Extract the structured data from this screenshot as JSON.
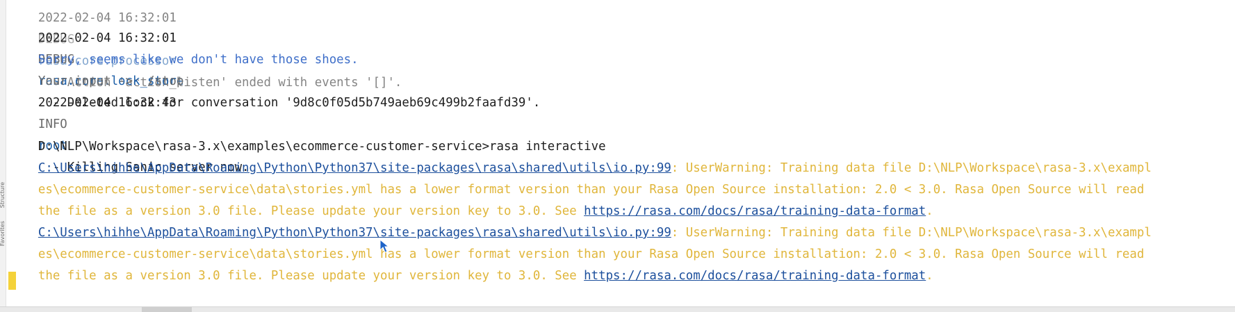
{
  "window": {
    "side_labels": [
      "Structure",
      "Favorites"
    ]
  },
  "lines": [
    {
      "ts": "2022-02-04 16:32:01",
      "level": "DEBUG",
      "logger": "rasa.core.processor",
      "msg": "  - Action 'action_listen' ended with events '[]'."
    },
    {
      "ts": "2022-02-04 16:32:01",
      "level": "DEBUG",
      "logger": "rasa.core.lock_store",
      "msg": "  - Deleted lock for conversation '9d8c0f05d5b749aeb69c499b2faafd39'."
    },
    {
      "bot": "Sorry, seems like we don't have those shoes."
    },
    {
      "prompt": "Your input ->  /stop"
    },
    {
      "ts": "2022-02-04 16:32:43",
      "level": "INFO",
      "logger": "root",
      "msg": "  - Killing Sanic server now."
    },
    {
      "command": "D:\\NLP\\Workspace\\rasa-3.x\\examples\\ecommerce-customer-service>rasa interactive"
    },
    {
      "path": "C:\\Users\\hihhe\\AppData\\Roaming\\Python\\Python37\\site-packages\\rasa\\shared\\utils\\io.py:99",
      "warn": ": UserWarning: Training data file D:\\NLP\\Workspace\\rasa-3.x\\exampl"
    },
    {
      "warn": "es\\ecommerce-customer-service\\data\\stories.yml has a lower format version than your Rasa Open Source installation: 2.0 < 3.0. Rasa Open Source will read"
    },
    {
      "warn": "the file as a version 3.0 file. Please update your version key to 3.0. See ",
      "url": "https://rasa.com/docs/rasa/training-data-format",
      "tail": "."
    },
    {
      "path": "C:\\Users\\hihhe\\AppData\\Roaming\\Python\\Python37\\site-packages\\rasa\\shared\\utils\\io.py:99",
      "warn": ": UserWarning: Training data file D:\\NLP\\Workspace\\rasa-3.x\\exampl"
    },
    {
      "warn": "es\\ecommerce-customer-service\\data\\stories.yml has a lower format version than your Rasa Open Source installation: 2.0 < 3.0. Rasa Open Source will read"
    },
    {
      "warn": "the file as a version 3.0 file. Please update your version key to 3.0. See ",
      "url": "https://rasa.com/docs/rasa/training-data-format",
      "tail": "."
    }
  ],
  "colors": {
    "warning": "#e0b63b",
    "link": "#1c4f9c",
    "logger": "#1d5fa8",
    "bot_message": "#3f6fc9",
    "caret": "#f4d23a"
  }
}
